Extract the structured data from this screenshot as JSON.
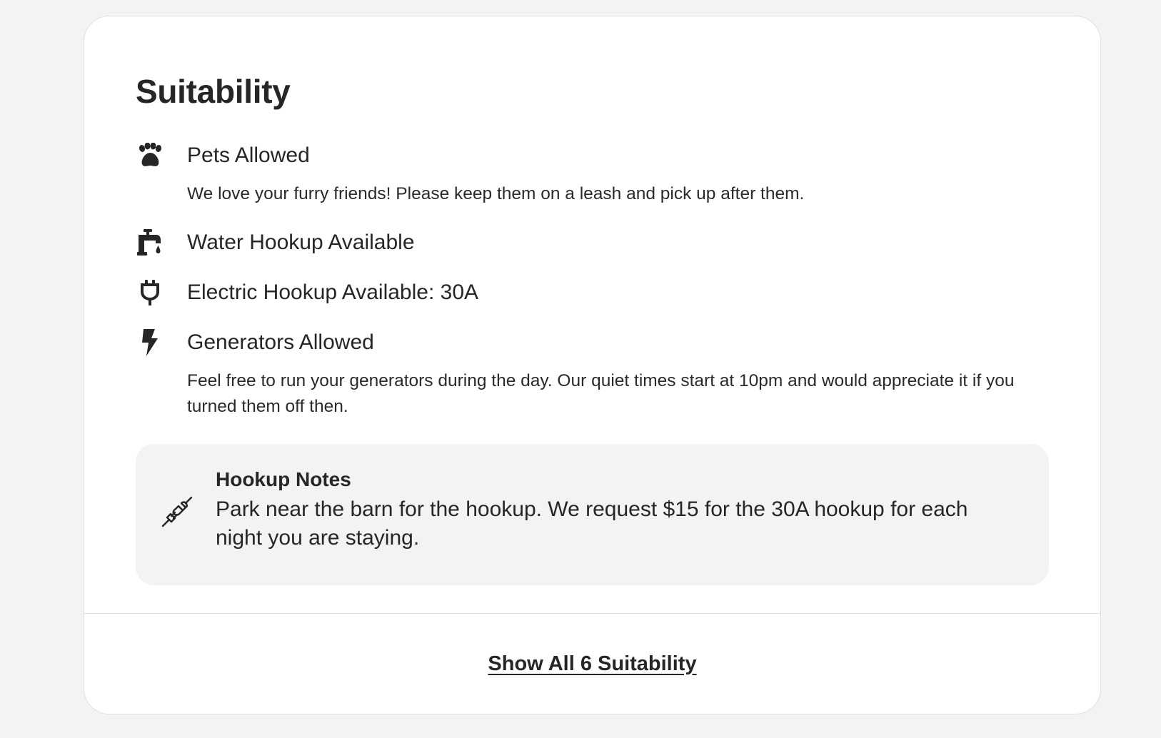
{
  "section": {
    "title": "Suitability"
  },
  "items": [
    {
      "icon": "paw-icon",
      "label": "Pets Allowed",
      "description": "We love your furry friends! Please keep them on a leash and pick up after them."
    },
    {
      "icon": "water-spigot-icon",
      "label": "Water Hookup Available",
      "description": ""
    },
    {
      "icon": "electric-plug-icon",
      "label": "Electric Hookup Available: 30A",
      "description": ""
    },
    {
      "icon": "lightning-bolt-icon",
      "label": "Generators Allowed",
      "description": "Feel free to run your generators during the day. Our quiet times start at 10pm and would appreciate it if you turned them off then."
    }
  ],
  "notes": {
    "icon": "plug-connect-icon",
    "title": "Hookup Notes",
    "body": "Park near the barn for the hookup. We request $15 for the 30A hookup for each night you are staying."
  },
  "footer": {
    "show_all_label": "Show All 6 Suitability"
  },
  "colors": {
    "page_background": "#f4f3f1",
    "card_background": "#ffffff",
    "text": "#262626",
    "notes_background": "#f4f3f1",
    "border": "#e3e1dd"
  }
}
